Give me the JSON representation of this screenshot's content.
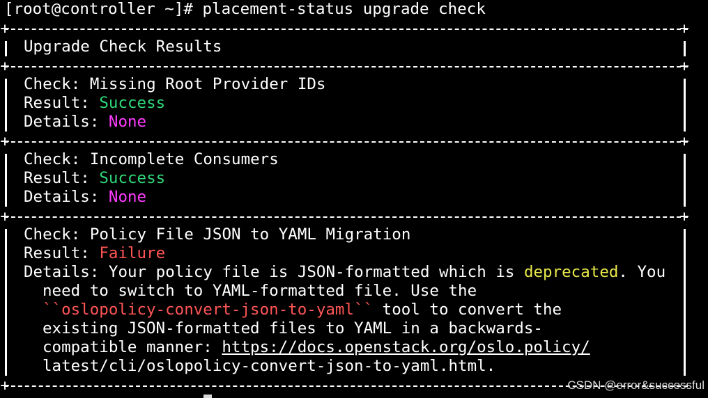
{
  "terminal": {
    "prompt": "[root@controller ~]# ",
    "command": "placement-status upgrade check",
    "table_title": "Upgrade Check Results",
    "labels": {
      "check": "Check: ",
      "result": "Result: ",
      "details": "Details: "
    },
    "checks": [
      {
        "name": "Missing Root Provider IDs",
        "result": "Success",
        "details": "None"
      },
      {
        "name": "Incomplete Consumers",
        "result": "Success",
        "details": "None"
      },
      {
        "name": "Policy File JSON to YAML Migration",
        "result": "Failure",
        "details_intro": "Your policy file is JSON-formatted which is ",
        "details_highlight": "deprecated",
        "details_after": ". You",
        "details_line2": "need to switch to YAML-formatted file. Use the",
        "details_tool_open": "``",
        "details_tool": "oslopolicy-convert-json-to-yaml",
        "details_tool_close": "``",
        "details_tool_after": " tool to convert the",
        "details_line4": "existing JSON-formatted files to YAML in a backwards-",
        "details_line5_prefix": "compatible manner: ",
        "details_link": "https://docs.openstack.org/oslo.policy/",
        "details_line6": "latest/cli/oslopolicy-convert-json-to-yaml.html."
      }
    ]
  },
  "watermark": "CSDN @error&successful",
  "colors": {
    "background": "#000000",
    "success": "#2fd97a",
    "none": "#ff3cff",
    "failure": "#ff5555",
    "deprecated": "#e8e84a"
  }
}
